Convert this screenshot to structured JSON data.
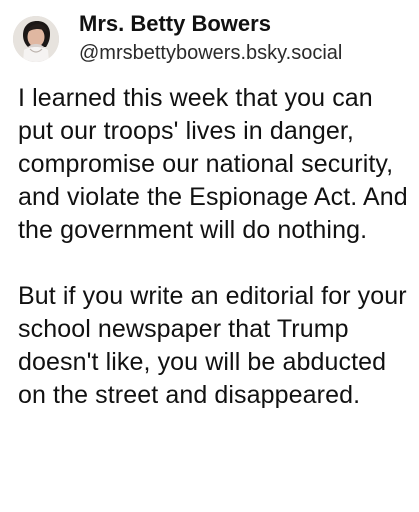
{
  "post": {
    "author": {
      "display_name": "Mrs. Betty Bowers",
      "handle": "@mrsbettybowers.bsky.social",
      "avatar_icon": "avatar-portrait-icon"
    },
    "body": {
      "paragraphs": [
        "I learned this week that you can put our troops' lives in danger, compromise our national security, and violate the Espionage Act. And the government will do nothing.",
        "But if you write an editorial for your school newspaper that Trump doesn't like, you will be abducted on the street and disappeared."
      ]
    }
  }
}
